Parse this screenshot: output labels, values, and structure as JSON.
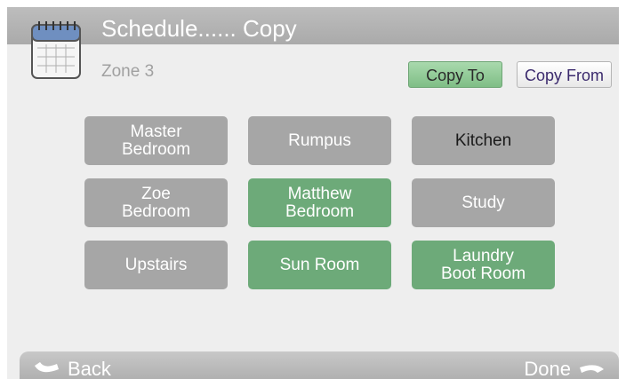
{
  "header": {
    "title": "Schedule...... Copy",
    "icon": "calendar-icon"
  },
  "zone_label": "Zone 3",
  "actions": {
    "copy_to_label": "Copy To",
    "copy_from_label": "Copy From",
    "copy_to_selected": true
  },
  "zones": [
    {
      "label": "Master\nBedroom",
      "selected": false
    },
    {
      "label": "Rumpus",
      "selected": false
    },
    {
      "label": "Kitchen",
      "selected": false,
      "current": true
    },
    {
      "label": "Zoe\nBedroom",
      "selected": false
    },
    {
      "label": "Matthew\nBedroom",
      "selected": true
    },
    {
      "label": "Study",
      "selected": false
    },
    {
      "label": "Upstairs",
      "selected": false
    },
    {
      "label": "Sun Room",
      "selected": true
    },
    {
      "label": "Laundry\nBoot Room",
      "selected": true
    }
  ],
  "footer": {
    "back_label": "Back",
    "done_label": "Done",
    "back_icon": "back-arrow-icon",
    "done_icon": "forward-arrow-icon"
  },
  "colors": {
    "header": "#aaaaaa",
    "selected_zone": "#6daa79",
    "unselected_zone": "#a6a6a6",
    "copy_to": "#8fc996",
    "background": "#eeeeee"
  }
}
